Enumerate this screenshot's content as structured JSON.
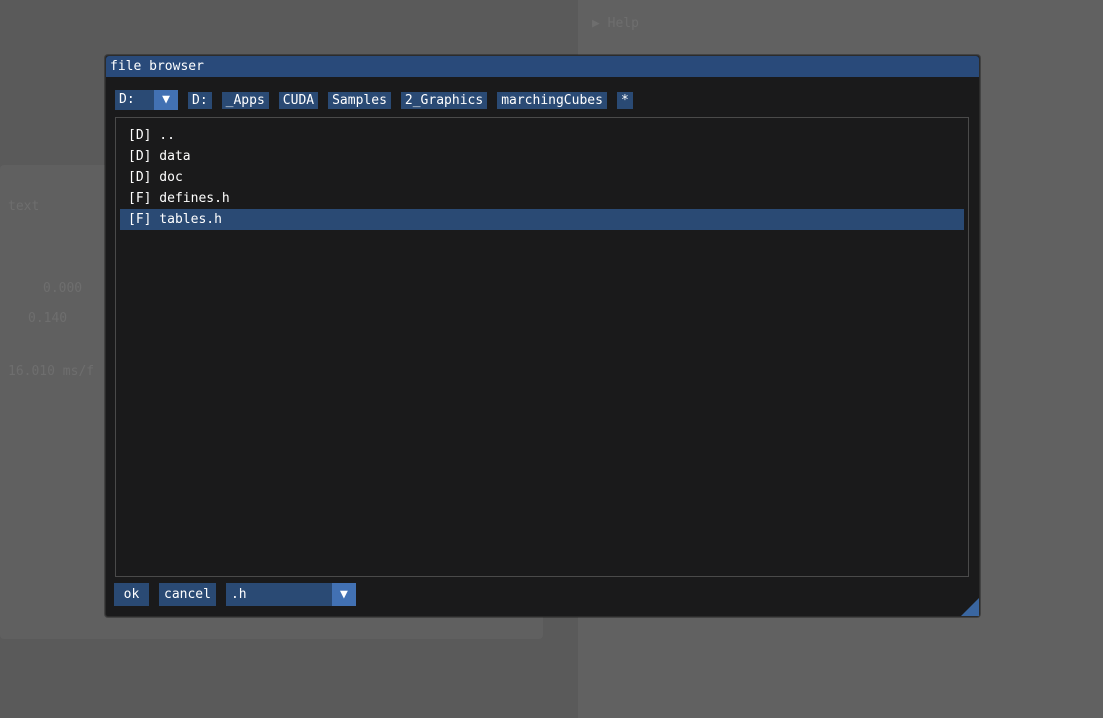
{
  "background": {
    "right_top_line": "...",
    "right_item_1": "▶ Help",
    "left_text_1": "text",
    "left_value_1": "0.000",
    "left_value_2": "0.140",
    "left_perf": "16.010 ms/f"
  },
  "dialog": {
    "title": "file browser",
    "drive": {
      "value": "D:",
      "arrow": "▼"
    },
    "breadcrumbs": [
      "D:",
      "_Apps",
      "CUDA",
      "Samples",
      "2_Graphics",
      "marchingCubes",
      "*"
    ],
    "entries": [
      {
        "text": "[D] ..",
        "selected": false
      },
      {
        "text": "[D] data",
        "selected": false
      },
      {
        "text": "[D] doc",
        "selected": false
      },
      {
        "text": "[F] defines.h",
        "selected": false
      },
      {
        "text": "[F] tables.h",
        "selected": true
      }
    ],
    "ok_label": "ok",
    "cancel_label": "cancel",
    "filter": {
      "value": ".h",
      "arrow": "▼"
    }
  },
  "colors": {
    "title_bg": "#294a7a",
    "button_bg": "#2a4a74",
    "arrow_bg": "#4271b3",
    "dialog_bg": "#1a1a1b"
  }
}
